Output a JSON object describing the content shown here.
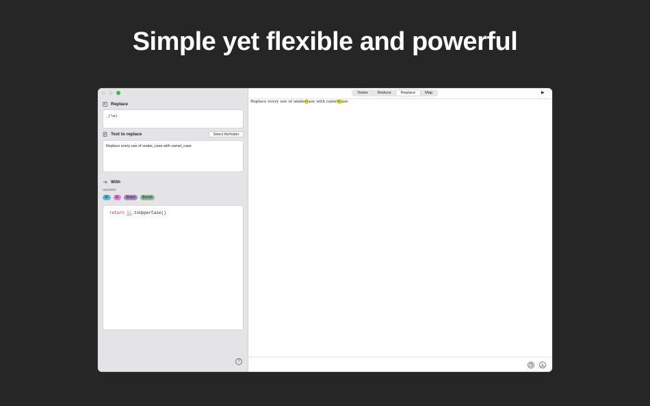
{
  "headline": "Simple yet flexible and powerful",
  "sidebar": {
    "replace_section": {
      "title": "Replace",
      "pattern": "_(\\w)"
    },
    "text_section": {
      "title": "Text to replace",
      "select_button": "Select file/folder",
      "text": "Replace every use of snake_case with camel_case"
    },
    "with_section": {
      "title": "With",
      "variables_label": "Variables",
      "variables": [
        {
          "label": "$0",
          "color": "#5bc0d8"
        },
        {
          "label": "$1",
          "color": "#e57ee0"
        },
        {
          "label": "$input",
          "color": "#a98dc0"
        },
        {
          "label": "$result",
          "color": "#8fb89a"
        }
      ],
      "code": {
        "keyword": "return",
        "variable": "$1",
        "rest": ".toUpperCase()"
      }
    },
    "help_icon": "?"
  },
  "main": {
    "tabs": [
      {
        "label": "Tester",
        "active": false
      },
      {
        "label": "Reduce",
        "active": false
      },
      {
        "label": "Replace",
        "active": true
      },
      {
        "label": "Map",
        "active": false
      }
    ],
    "run_icon": "▶",
    "result": {
      "part1": "Replace every use of snake",
      "hl1": "C",
      "part2": "ase with camel",
      "hl2": "C",
      "part3": "ase"
    }
  }
}
